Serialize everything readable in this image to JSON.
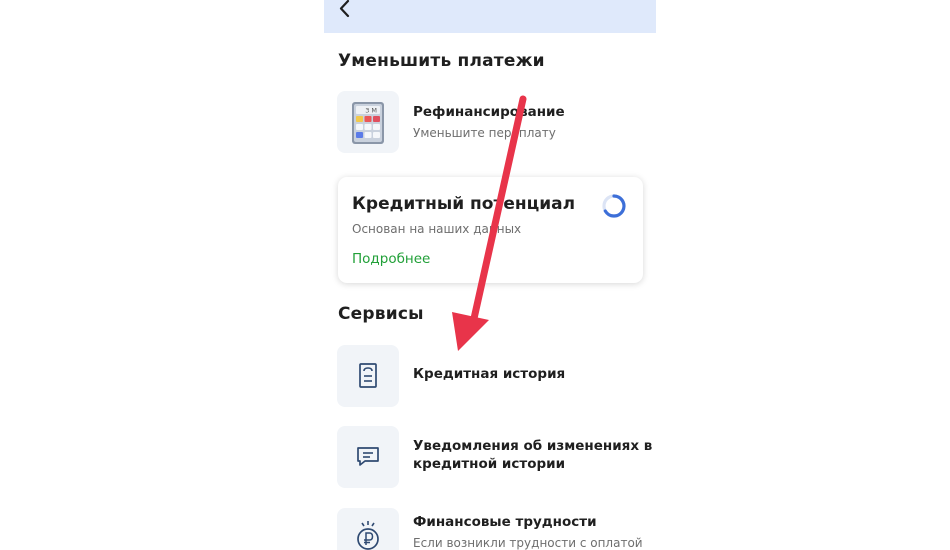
{
  "header": {
    "back_icon": "chevron-left-icon",
    "background": "#dfe9fb"
  },
  "reduce_payments": {
    "title": "Уменьшить платежи",
    "refinance": {
      "title": "Рефинансирование",
      "subtitle": "Уменьшите переплату",
      "icon": "calculator-icon",
      "calculator_display": "3 M"
    }
  },
  "credit_potential": {
    "title": "Кредитный потенциал",
    "subtitle": "Основан на наших данных",
    "link": "Подробнее",
    "link_color": "#21a038",
    "loading_icon": "spinner-icon"
  },
  "services": {
    "title": "Сервисы",
    "items": [
      {
        "title": "Кредитная история",
        "icon": "document-icon"
      },
      {
        "title_line1": "Уведомления об изменениях в",
        "title_line2": "кредитной истории",
        "icon": "chat-icon"
      },
      {
        "title": "Финансовые трудности",
        "subtitle": "Если возникли трудности с оплатой",
        "icon": "ruble-coin-icon"
      }
    ]
  },
  "annotation": {
    "color": "#e8344a",
    "icon": "red-arrow-annotation"
  }
}
